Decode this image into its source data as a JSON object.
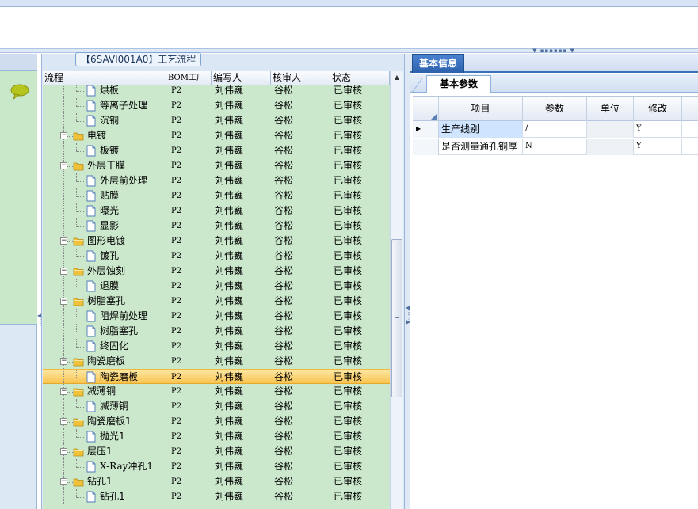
{
  "tree_panel": {
    "title": "【6SAVI001A0】工艺流程",
    "columns": [
      "流程",
      "BOM工厂",
      "编写人",
      "核审人",
      "状态"
    ],
    "rows": [
      {
        "name": "烘板",
        "type": "doc",
        "level": 2,
        "bom": "P2",
        "author": "刘伟巍",
        "reviewer": "谷松",
        "status": "已审核"
      },
      {
        "name": "等离子处理",
        "type": "doc",
        "level": 2,
        "bom": "P2",
        "author": "刘伟巍",
        "reviewer": "谷松",
        "status": "已审核"
      },
      {
        "name": "沉铜",
        "type": "doc",
        "level": 2,
        "bom": "P2",
        "author": "刘伟巍",
        "reviewer": "谷松",
        "status": "已审核"
      },
      {
        "name": "电镀",
        "type": "folder",
        "level": 1,
        "bom": "P2",
        "author": "刘伟巍",
        "reviewer": "谷松",
        "status": "已审核"
      },
      {
        "name": "板镀",
        "type": "doc",
        "level": 2,
        "bom": "P2",
        "author": "刘伟巍",
        "reviewer": "谷松",
        "status": "已审核"
      },
      {
        "name": "外层干膜",
        "type": "folder",
        "level": 1,
        "bom": "P2",
        "author": "刘伟巍",
        "reviewer": "谷松",
        "status": "已审核"
      },
      {
        "name": "外层前处理",
        "type": "doc",
        "level": 2,
        "bom": "P2",
        "author": "刘伟巍",
        "reviewer": "谷松",
        "status": "已审核"
      },
      {
        "name": "贴膜",
        "type": "doc",
        "level": 2,
        "bom": "P2",
        "author": "刘伟巍",
        "reviewer": "谷松",
        "status": "已审核"
      },
      {
        "name": "曝光",
        "type": "doc",
        "level": 2,
        "bom": "P2",
        "author": "刘伟巍",
        "reviewer": "谷松",
        "status": "已审核"
      },
      {
        "name": "显影",
        "type": "doc",
        "level": 2,
        "bom": "P2",
        "author": "刘伟巍",
        "reviewer": "谷松",
        "status": "已审核"
      },
      {
        "name": "图形电镀",
        "type": "folder",
        "level": 1,
        "bom": "P2",
        "author": "刘伟巍",
        "reviewer": "谷松",
        "status": "已审核"
      },
      {
        "name": "镀孔",
        "type": "doc",
        "level": 2,
        "bom": "P2",
        "author": "刘伟巍",
        "reviewer": "谷松",
        "status": "已审核"
      },
      {
        "name": "外层蚀刻",
        "type": "folder",
        "level": 1,
        "bom": "P2",
        "author": "刘伟巍",
        "reviewer": "谷松",
        "status": "已审核"
      },
      {
        "name": "退膜",
        "type": "doc",
        "level": 2,
        "bom": "P2",
        "author": "刘伟巍",
        "reviewer": "谷松",
        "status": "已审核"
      },
      {
        "name": "树脂塞孔",
        "type": "folder",
        "level": 1,
        "bom": "P2",
        "author": "刘伟巍",
        "reviewer": "谷松",
        "status": "已审核"
      },
      {
        "name": "阻焊前处理",
        "type": "doc",
        "level": 2,
        "bom": "P2",
        "author": "刘伟巍",
        "reviewer": "谷松",
        "status": "已审核"
      },
      {
        "name": "树脂塞孔",
        "type": "doc",
        "level": 2,
        "bom": "P2",
        "author": "刘伟巍",
        "reviewer": "谷松",
        "status": "已审核"
      },
      {
        "name": "终固化",
        "type": "doc",
        "level": 2,
        "bom": "P2",
        "author": "刘伟巍",
        "reviewer": "谷松",
        "status": "已审核"
      },
      {
        "name": "陶瓷磨板",
        "type": "folder",
        "level": 1,
        "bom": "P2",
        "author": "刘伟巍",
        "reviewer": "谷松",
        "status": "已审核"
      },
      {
        "name": "陶瓷磨板",
        "type": "doc",
        "level": 2,
        "bom": "P2",
        "author": "刘伟巍",
        "reviewer": "谷松",
        "status": "已审核",
        "selected": true
      },
      {
        "name": "减薄铜",
        "type": "folder",
        "level": 1,
        "bom": "P2",
        "author": "刘伟巍",
        "reviewer": "谷松",
        "status": "已审核"
      },
      {
        "name": "减薄铜",
        "type": "doc",
        "level": 2,
        "bom": "P2",
        "author": "刘伟巍",
        "reviewer": "谷松",
        "status": "已审核"
      },
      {
        "name": "陶瓷磨板1",
        "type": "folder",
        "level": 1,
        "bom": "P2",
        "author": "刘伟巍",
        "reviewer": "谷松",
        "status": "已审核"
      },
      {
        "name": "抛光1",
        "type": "doc",
        "level": 2,
        "bom": "P2",
        "author": "刘伟巍",
        "reviewer": "谷松",
        "status": "已审核"
      },
      {
        "name": "层压1",
        "type": "folder",
        "level": 1,
        "bom": "P2",
        "author": "刘伟巍",
        "reviewer": "谷松",
        "status": "已审核"
      },
      {
        "name": "X-Ray冲孔1",
        "type": "doc",
        "level": 2,
        "bom": "P2",
        "author": "刘伟巍",
        "reviewer": "谷松",
        "status": "已审核"
      },
      {
        "name": "钻孔1",
        "type": "folder",
        "level": 1,
        "bom": "P2",
        "author": "刘伟巍",
        "reviewer": "谷松",
        "status": "已审核"
      },
      {
        "name": "钻孔1",
        "type": "doc",
        "level": 2,
        "bom": "P2",
        "author": "刘伟巍",
        "reviewer": "谷松",
        "status": "已审核"
      }
    ]
  },
  "right_panel": {
    "tab_main": "基本信息",
    "tab_sub": "基本参数",
    "grid_columns": [
      "项目",
      "参数",
      "单位",
      "修改"
    ],
    "grid_rows": [
      {
        "item": "生产线别",
        "param": "/",
        "unit": "",
        "modify": "Y",
        "current": true
      },
      {
        "item": "是否测量通孔铜厚",
        "param": "N",
        "unit": "",
        "modify": "Y",
        "current": false
      }
    ]
  },
  "colors": {
    "tree_bg": "#cbe8cd",
    "selected_row": "#f9c450",
    "tab_active": "#2d61ad",
    "folder": "#f0c23a"
  }
}
